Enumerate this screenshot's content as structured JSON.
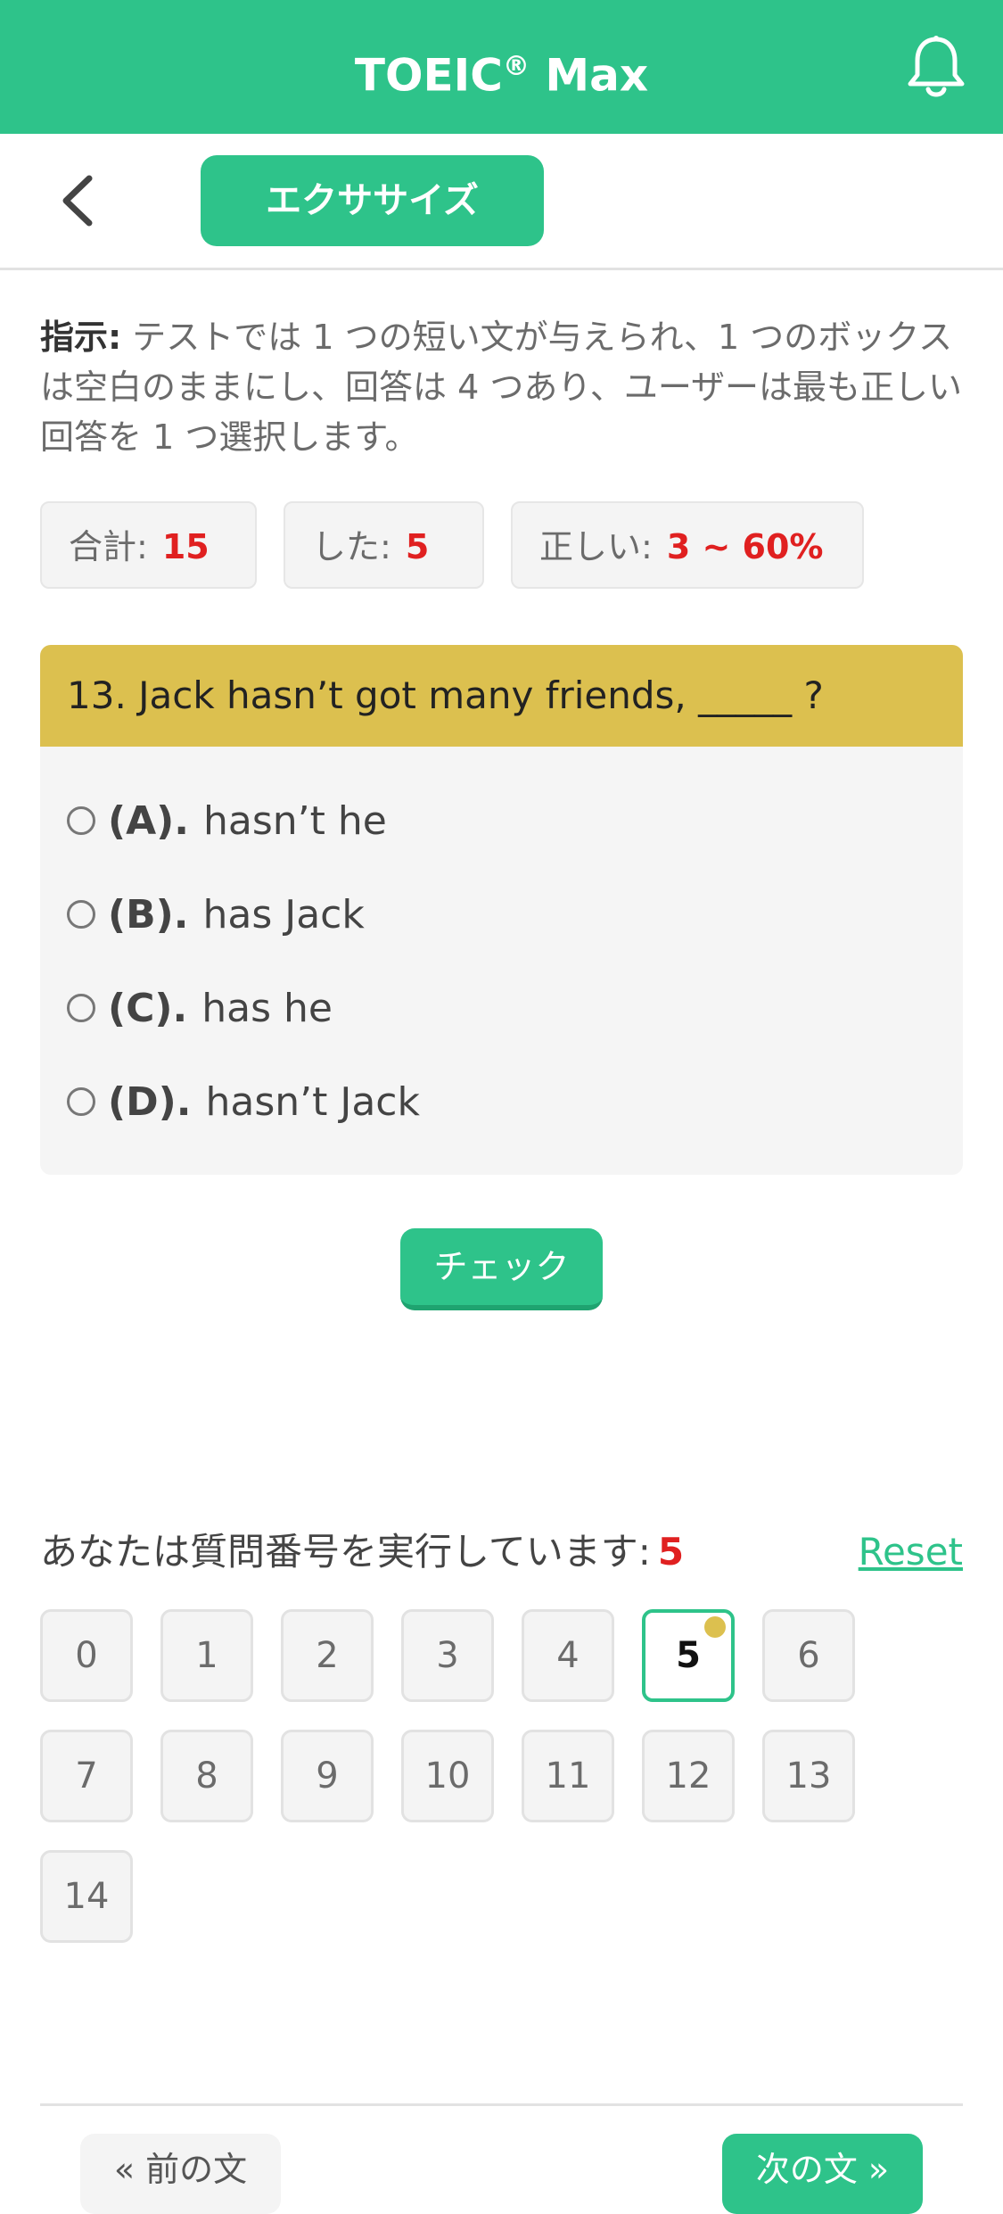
{
  "header": {
    "title": "TOEIC",
    "title_mark": "®",
    "title_suffix": " Max",
    "bell_icon": "bell-icon"
  },
  "nav": {
    "back_icon": "chevron-left-icon",
    "tab_label": "エクササイズ"
  },
  "instruction": {
    "label": "指示:",
    "text": " テストでは 1 つの短い文が与えられ、1 つのボックスは空白のままにし、回答は 4 つあり、ユーザーは最も正しい回答を 1 つ選択します。"
  },
  "stats": {
    "total_label": "合計:",
    "total_value": "15",
    "done_label": "した:",
    "done_value": "5",
    "correct_label": "正しい:",
    "correct_value": "3 ~ 60%"
  },
  "question": {
    "text": "13. Jack hasn’t got many friends, _____ ?",
    "options": [
      {
        "key": "(A).",
        "text": "hasn’t he"
      },
      {
        "key": "(B).",
        "text": "has Jack"
      },
      {
        "key": "(C).",
        "text": "has he"
      },
      {
        "key": "(D).",
        "text": "hasn’t Jack"
      }
    ]
  },
  "check_button": "チェック",
  "progress": {
    "label": "あなたは質問番号を実行しています:",
    "current": "5",
    "reset": "Reset",
    "numbers": [
      "0",
      "1",
      "2",
      "3",
      "4",
      "5",
      "6",
      "7",
      "8",
      "9",
      "10",
      "11",
      "12",
      "13",
      "14"
    ]
  },
  "footer": {
    "prev": "« 前の文",
    "next": "次の文 »"
  },
  "colors": {
    "primary": "#2ec38a",
    "question_header": "#dcc04f",
    "accent_red": "#e02020"
  }
}
